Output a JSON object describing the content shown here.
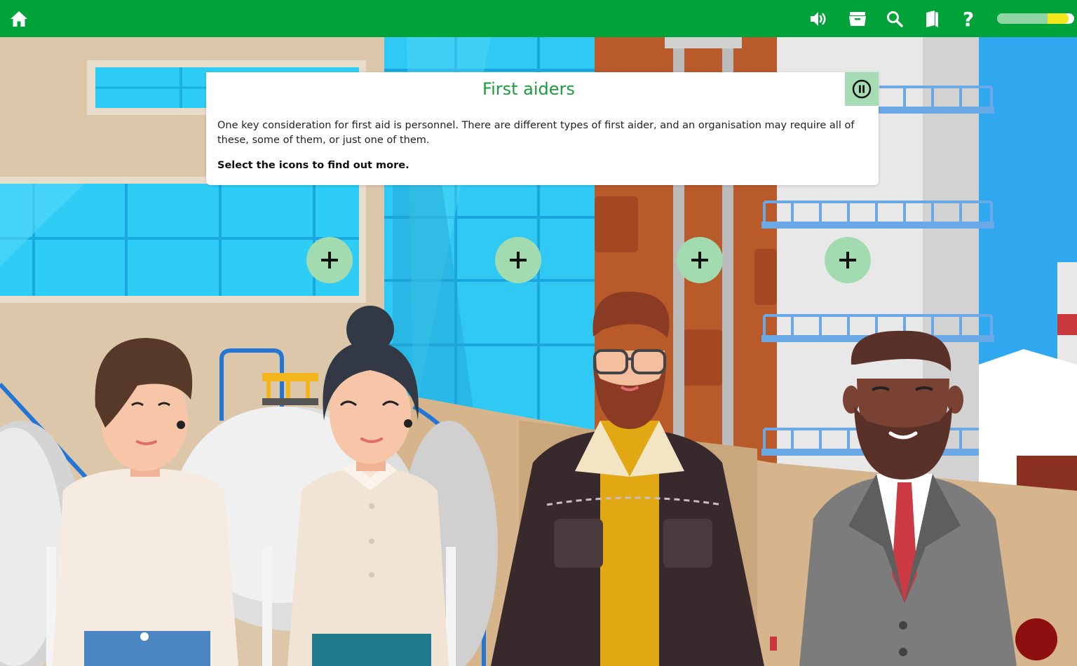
{
  "topbar": {
    "icons": [
      "home-icon",
      "audio-icon",
      "resources-icon",
      "search-icon",
      "glossary-icon",
      "help-icon"
    ],
    "help_label": "?",
    "progress": 0.93,
    "bar_color": "#00a339"
  },
  "card": {
    "title": "First aiders",
    "body": "One key consideration for first aid is personnel. There are different types of first aider, and an organisation may require all of these, some of them, or just one of them.",
    "cta": "Select the icons to find out more.",
    "title_color": "#1e9a3f"
  },
  "hotspots": [
    {
      "label": "+"
    },
    {
      "label": "+"
    },
    {
      "label": "+"
    },
    {
      "label": "+"
    }
  ]
}
